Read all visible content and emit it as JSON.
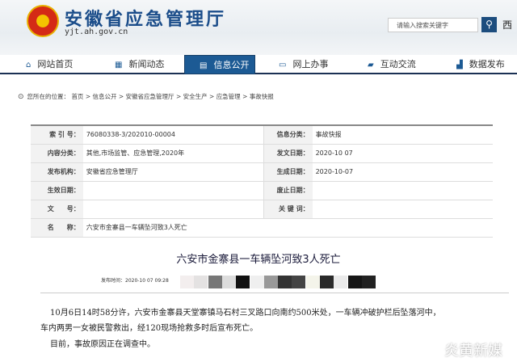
{
  "header": {
    "title": "安徽省应急管理厅",
    "url": "yjt.ah.gov.cn",
    "search_placeholder": "请输入搜索关键字",
    "search_icon": "search-icon",
    "top_link": "西"
  },
  "nav": [
    {
      "label": "网站首页",
      "icon": "home-icon"
    },
    {
      "label": "新闻动态",
      "icon": "news-icon"
    },
    {
      "label": "信息公开",
      "icon": "document-icon",
      "active": true
    },
    {
      "label": "网上办事",
      "icon": "monitor-icon"
    },
    {
      "label": "互动交流",
      "icon": "chat-icon"
    },
    {
      "label": "数据发布",
      "icon": "chart-icon"
    }
  ],
  "breadcrumb": {
    "prefix": "您所在的位置：",
    "items": [
      "首页",
      "信息公开",
      "安徽省应急管理厅",
      "安全生产",
      "应急管理",
      "事故快报"
    ]
  },
  "meta": {
    "index_label": "索 引 号：",
    "index_value": "76080338-3/202010-00004",
    "info_cat_label": "信息分类：",
    "info_cat_value": "事故快报",
    "content_cat_label": "内容分类：",
    "content_cat_value": "其他,市场监管、应急管理,2020年",
    "pub_date_label": "发文日期：",
    "pub_date_value": "2020-10 07",
    "org_label": "发布机构：",
    "org_value": "安徽省应急管理厅",
    "gen_date_label": "生成日期：",
    "gen_date_value": "2020-10-07",
    "eff_date_label": "生效日期：",
    "eff_date_value": "",
    "exp_label": "废止日期：",
    "exp_value": "",
    "doc_no_label": "文　　号：",
    "doc_no_value": "",
    "keywords_label": "关 键 词：",
    "keywords_value": "",
    "name_label": "名　　称：",
    "name_value": "六安市金寨县一车辆坠河致3人死亡"
  },
  "article": {
    "title": "六安市金寨县一车辆坠河致3人死亡",
    "publish_label": "发布时间：2020-10 07 09:28",
    "mosaic_colors": [
      "#f3eeee",
      "#e4e2e2",
      "#777",
      "#dcdcdc",
      "#111",
      "#efefef",
      "#999",
      "#333",
      "#444",
      "#f4f4ea",
      "#2a2a2a",
      "#eaeaea",
      "#161616",
      "#222"
    ],
    "paragraphs": [
      "10月6日14时58分许，六安市金寨县天堂寨镇马石村三叉路口向南约500米处，一车辆冲破护栏后坠落河中，",
      "车内两男一女被民警救出，经120现场抢救多时后宣布死亡。",
      "目前，事故原因正在调查中。"
    ]
  },
  "watermark": "炎黄新媒"
}
